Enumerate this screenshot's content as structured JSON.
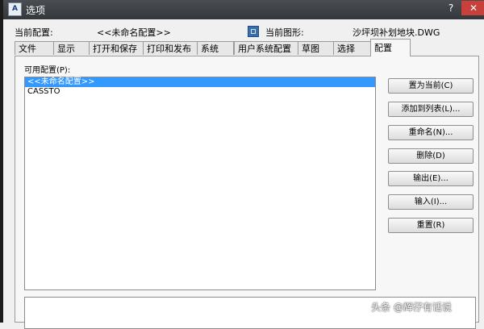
{
  "window": {
    "title": "选项",
    "app_icon_text": "A",
    "help_glyph": "?",
    "close_glyph": "✕"
  },
  "info": {
    "current_profile_label": "当前配置:",
    "current_profile_value": "<<未命名配置>>",
    "current_drawing_label": "当前图形:",
    "current_drawing_value": "沙坪坝补划地块.DWG",
    "drawing_icon": "dwg-file-icon"
  },
  "tabs": [
    {
      "label": "文件"
    },
    {
      "label": "显示"
    },
    {
      "label": "打开和保存"
    },
    {
      "label": "打印和发布"
    },
    {
      "label": "系统"
    },
    {
      "label": "用户系统配置"
    },
    {
      "label": "草图"
    },
    {
      "label": "选择"
    },
    {
      "label": "配置",
      "active": true
    }
  ],
  "profiles": {
    "label": "可用配置(P):",
    "items": [
      {
        "text": "<<未命名配置>>",
        "selected": true
      },
      {
        "text": "CASSTO",
        "selected": false
      }
    ]
  },
  "buttons": {
    "set_current": "置为当前(C)",
    "add_to_list": "添加到列表(L)...",
    "rename": "重命名(N)...",
    "delete": "删除(D)",
    "export": "输出(E)...",
    "import": "输入(I)...",
    "reset": "重置(R)"
  },
  "watermark": "头条 @辉仔有话说",
  "colors": {
    "selection": "#3399ff",
    "title_bar": "#3c3f44",
    "close_button": "#c9403a"
  }
}
